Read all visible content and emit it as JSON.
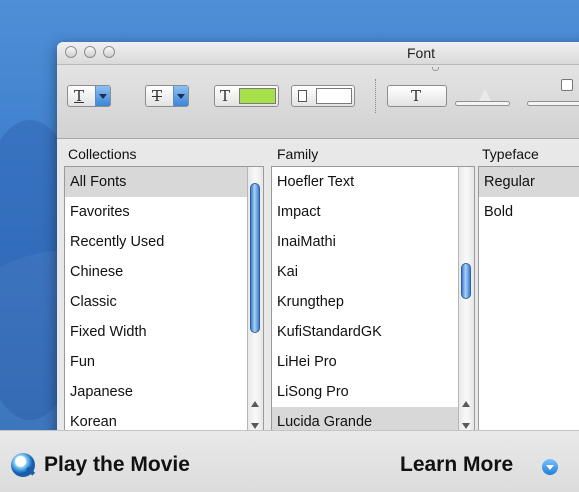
{
  "window": {
    "title": "Font"
  },
  "toolbar": {
    "underline_glyph": "T",
    "strikethrough_glyph": "T",
    "text_color_glyph": "T",
    "text_color_value": "#a6e04a",
    "document_color_value": "#ffffff",
    "shadow_glyph": "T"
  },
  "collections": {
    "header": "Collections",
    "items": [
      "All Fonts",
      "Favorites",
      "Recently Used",
      "Chinese",
      "Classic",
      "Fixed Width",
      "Fun",
      "Japanese",
      "Korean"
    ],
    "selected": "All Fonts"
  },
  "family": {
    "header": "Family",
    "items": [
      "Hoefler Text",
      "Impact",
      "InaiMathi",
      "Kai",
      "Krungthep",
      "KufiStandardGK",
      "LiHei Pro",
      "LiSong Pro",
      "Lucida Grande"
    ],
    "selected": "Lucida Grande"
  },
  "typeface": {
    "header": "Typeface",
    "items": [
      "Regular",
      "Bold"
    ],
    "selected": "Regular"
  },
  "footer": {
    "play_label": "Play the Movie",
    "learn_label": "Learn More"
  },
  "icons": {
    "play": "quicktime-icon",
    "learn": "circle-down-arrow-icon"
  }
}
